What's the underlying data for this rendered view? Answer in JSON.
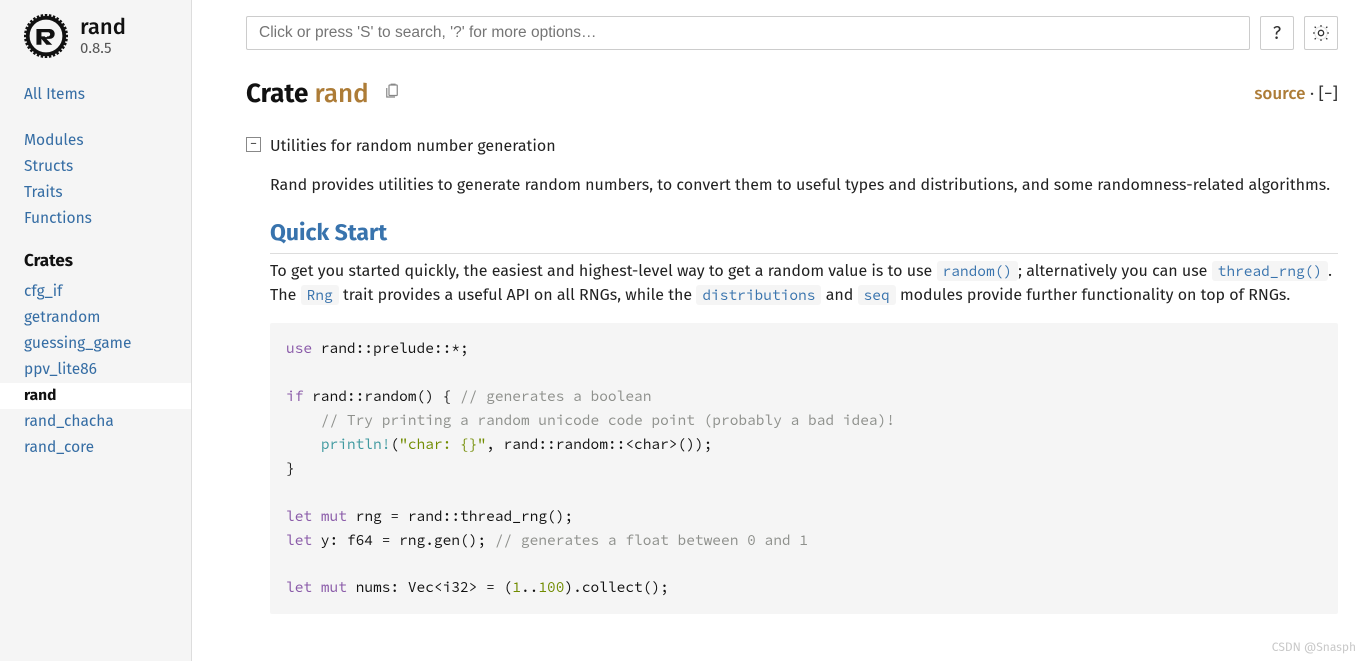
{
  "sidebar": {
    "crate_name": "rand",
    "version": "0.8.5",
    "all_items": "All Items",
    "nav": [
      "Modules",
      "Structs",
      "Traits",
      "Functions"
    ],
    "crates_heading": "Crates",
    "crates": [
      "cfg_if",
      "getrandom",
      "guessing_game",
      "ppv_lite86",
      "rand",
      "rand_chacha",
      "rand_core"
    ],
    "current_crate": "rand"
  },
  "search": {
    "placeholder": "Click or press 'S' to search, '?' for more options…"
  },
  "help_label": "?",
  "title": {
    "prefix": "Crate ",
    "name": "rand"
  },
  "titlebar": {
    "source": "source",
    "sep": " · ",
    "collapse": "[−]"
  },
  "toggle": "−",
  "doc": {
    "summary": "Utilities for random number generation",
    "intro": "Rand provides utilities to generate random numbers, to convert them to useful types and distributions, and some randomness-related algorithms.",
    "quick_start_heading": "Quick Start",
    "qs_before_random": "To get you started quickly, the easiest and highest-level way to get a random value is to use ",
    "code_random": "random()",
    "qs_after_random": "; alternatively you can use ",
    "code_threadrng": "thread_rng()",
    "qs_dot_the": ". The ",
    "code_rng": "Rng",
    "qs_trait": " trait provides a useful API on all RNGs, while the ",
    "code_distributions": "distributions",
    "qs_and": " and ",
    "code_seq": "seq",
    "qs_tail": " modules provide further functionality on top of RNGs."
  },
  "code": {
    "l1_use": "use",
    "l1_rest": " rand::prelude::",
    "l1_star": "*",
    "l1_semi": ";",
    "l3_if": "if",
    "l3_cond": " rand::random() { ",
    "l3_c": "// generates a boolean",
    "l4_c": "    // Try printing a random unicode code point (probably a bad idea)!",
    "l5_indent": "    ",
    "l5_macro": "println!",
    "l5_open": "(",
    "l5_str": "\"char: {}\"",
    "l5_rest": ", rand::random::<char>());",
    "l6": "}",
    "l8_let": "let",
    "l8_mut": " mut",
    "l8_rest": " rng = rand::thread_rng();",
    "l9_let": "let",
    "l9_rest": " y: f64 = rng.gen(); ",
    "l9_c": "// generates a float between 0 and 1",
    "l11_let": "let",
    "l11_mut": " mut",
    "l11_a": " nums: Vec<i32> = (",
    "l11_n1": "1",
    "l11_dd": "..",
    "l11_n2": "100",
    "l11_b": ").collect();"
  },
  "watermark": "CSDN @Snasph"
}
